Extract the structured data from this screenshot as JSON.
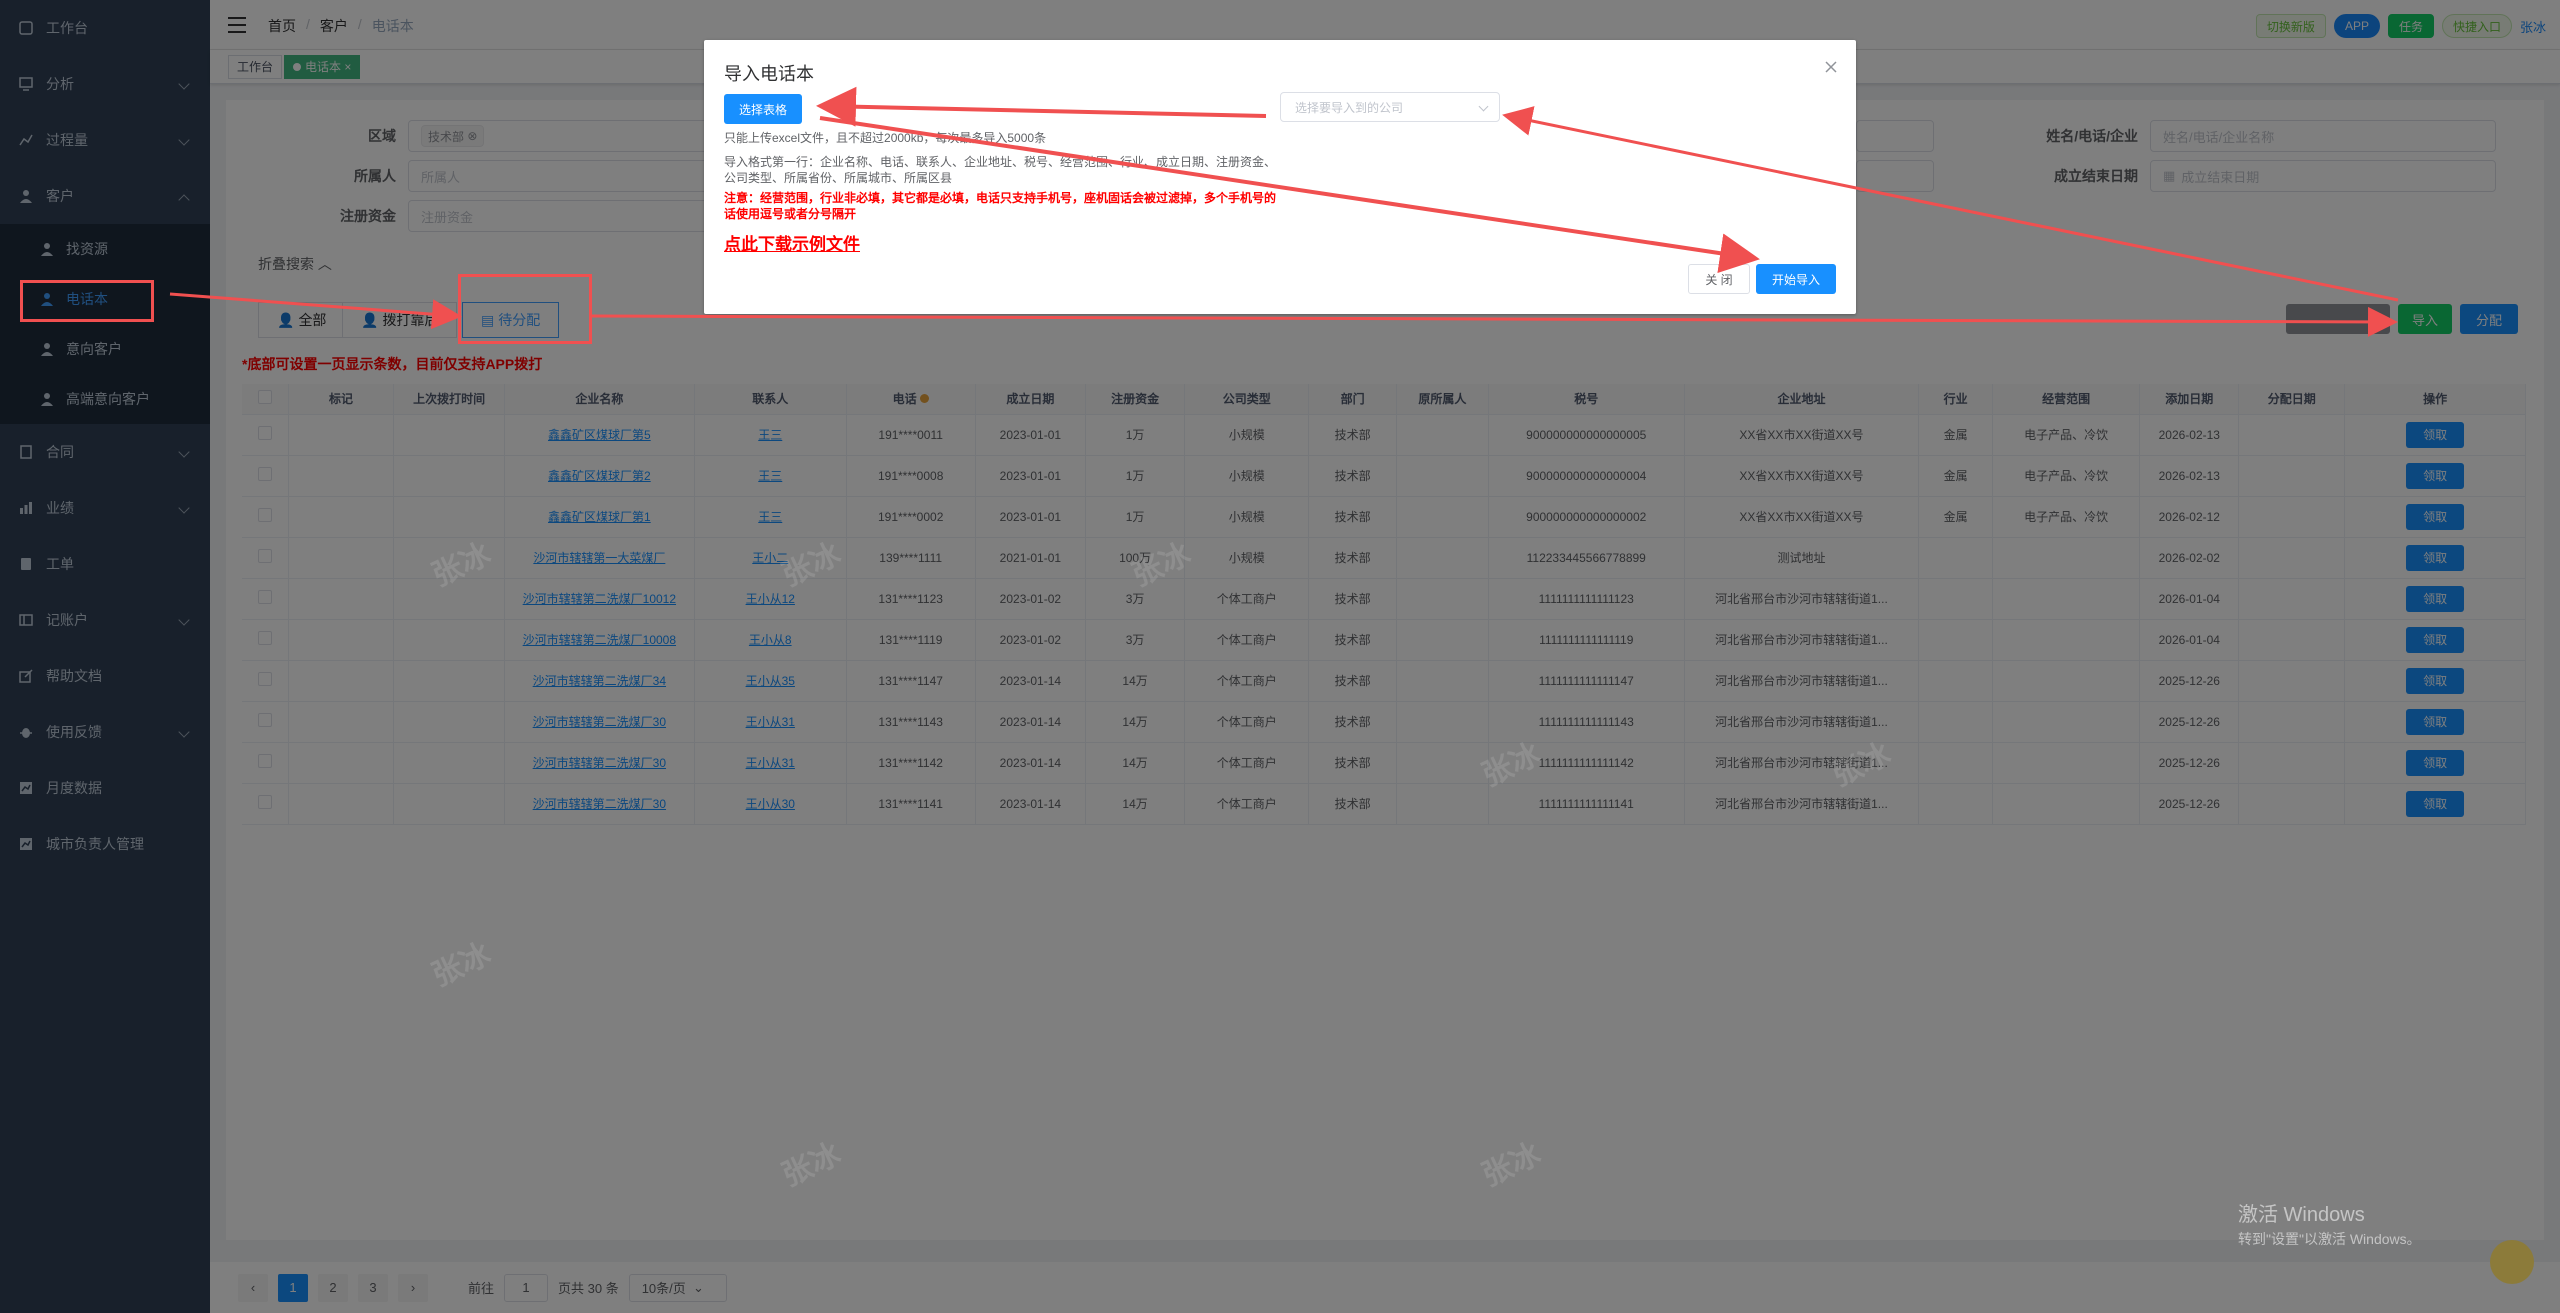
{
  "sidebar": {
    "items": [
      {
        "label": "工作台",
        "icon": "dashboard-icon"
      },
      {
        "label": "分析",
        "icon": "chart-icon"
      },
      {
        "label": "过程量",
        "icon": "process-icon"
      },
      {
        "label": "客户",
        "icon": "user-icon"
      },
      {
        "label": "合同",
        "icon": "contract-icon"
      },
      {
        "label": "业绩",
        "icon": "performance-icon"
      },
      {
        "label": "工单",
        "icon": "ticket-icon"
      },
      {
        "label": "记账户",
        "icon": "account-icon"
      },
      {
        "label": "帮助文档",
        "icon": "link-icon"
      },
      {
        "label": "使用反馈",
        "icon": "bug-icon"
      },
      {
        "label": "月度数据",
        "icon": "monthly-icon"
      },
      {
        "label": "城市负责人管理",
        "icon": "city-icon"
      }
    ],
    "customer_sub": [
      "找资源",
      "电话本",
      "意向客户",
      "高端意向客户"
    ]
  },
  "navbar": {
    "breadcrumb": [
      "首页",
      "客户",
      "电话本"
    ],
    "buttons": [
      "切换新版",
      "APP",
      "任务",
      "快捷入口"
    ],
    "user": "张冰"
  },
  "tags": [
    "工作台",
    "电话本"
  ],
  "filters": {
    "region_label": "区域",
    "region_chip": "技术部",
    "owner_label": "所属人",
    "owner_placeholder": "所属人",
    "capital_label": "注册资金",
    "capital_placeholder": "注册资金",
    "name_label": "姓名/电话/企业",
    "name_placeholder": "姓名/电话/企业名称",
    "end_date_label": "成立结束日期",
    "end_date_placeholder": "成立结束日期",
    "collapse": "折叠搜索"
  },
  "tabs": [
    "全部",
    "拨打靠后",
    "待分配"
  ],
  "tip": "*底部可设置一页显示条数，目前仅支持APP拨打",
  "actions": {
    "import": "导入",
    "assign": "分配"
  },
  "table": {
    "headers": [
      "标记",
      "上次拨打时间",
      "企业名称",
      "联系人",
      "电话",
      "成立日期",
      "注册资金",
      "公司类型",
      "部门",
      "原所属人",
      "税号",
      "企业地址",
      "行业",
      "经营范围",
      "添加日期",
      "分配日期",
      "操作"
    ],
    "action_label": "领取",
    "rows": [
      [
        "",
        "",
        "鑫鑫矿区煤球厂第5",
        "王三",
        "191****0011",
        "2023-01-01",
        "1万",
        "小规模",
        "技术部",
        "",
        "900000000000000005",
        "XX省XX市XX街道XX号",
        "金属",
        "电子产品、冷饮",
        "2026-02-13",
        ""
      ],
      [
        "",
        "",
        "鑫鑫矿区煤球厂第2",
        "王三",
        "191****0008",
        "2023-01-01",
        "1万",
        "小规模",
        "技术部",
        "",
        "900000000000000004",
        "XX省XX市XX街道XX号",
        "金属",
        "电子产品、冷饮",
        "2026-02-13",
        ""
      ],
      [
        "",
        "",
        "鑫鑫矿区煤球厂第1",
        "王三",
        "191****0002",
        "2023-01-01",
        "1万",
        "小规模",
        "技术部",
        "",
        "900000000000000002",
        "XX省XX市XX街道XX号",
        "金属",
        "电子产品、冷饮",
        "2026-02-12",
        ""
      ],
      [
        "",
        "",
        "沙河市辖辖第一大菜煤厂",
        "王小二",
        "139****1111",
        "2021-01-01",
        "100万",
        "小规模",
        "技术部",
        "",
        "112233445566778899",
        "测试地址",
        "",
        "",
        "2026-02-02",
        ""
      ],
      [
        "",
        "",
        "沙河市辖辖第二洗煤厂10012",
        "王小从12",
        "131****1123",
        "2023-01-02",
        "3万",
        "个体工商户",
        "技术部",
        "",
        "1111111111111123",
        "河北省邢台市沙河市辖辖街道1...",
        "",
        "",
        "2026-01-04",
        ""
      ],
      [
        "",
        "",
        "沙河市辖辖第二洗煤厂10008",
        "王小从8",
        "131****1119",
        "2023-01-02",
        "3万",
        "个体工商户",
        "技术部",
        "",
        "1111111111111119",
        "河北省邢台市沙河市辖辖街道1...",
        "",
        "",
        "2026-01-04",
        ""
      ],
      [
        "",
        "",
        "沙河市辖辖第二洗煤厂34",
        "王小从35",
        "131****1147",
        "2023-01-14",
        "14万",
        "个体工商户",
        "技术部",
        "",
        "1111111111111147",
        "河北省邢台市沙河市辖辖街道1...",
        "",
        "",
        "2025-12-26",
        ""
      ],
      [
        "",
        "",
        "沙河市辖辖第二洗煤厂30",
        "王小从31",
        "131****1143",
        "2023-01-14",
        "14万",
        "个体工商户",
        "技术部",
        "",
        "1111111111111143",
        "河北省邢台市沙河市辖辖街道1...",
        "",
        "",
        "2025-12-26",
        ""
      ],
      [
        "",
        "",
        "沙河市辖辖第二洗煤厂30",
        "王小从31",
        "131****1142",
        "2023-01-14",
        "14万",
        "个体工商户",
        "技术部",
        "",
        "1111111111111142",
        "河北省邢台市沙河市辖辖街道1...",
        "",
        "",
        "2025-12-26",
        ""
      ],
      [
        "",
        "",
        "沙河市辖辖第二洗煤厂30",
        "王小从30",
        "131****1141",
        "2023-01-14",
        "14万",
        "个体工商户",
        "技术部",
        "",
        "1111111111111141",
        "河北省邢台市沙河市辖辖街道1...",
        "",
        "",
        "2025-12-26",
        ""
      ]
    ]
  },
  "pagination": {
    "pages": [
      "1",
      "2",
      "3"
    ],
    "goto_label": "前往",
    "goto_value": "1",
    "total": "页共 30 条",
    "page_size": "10条/页"
  },
  "dialog": {
    "title": "导入电话本",
    "select_button": "选择表格",
    "company_placeholder": "选择要导入到的公司",
    "limit_text": "只能上传excel文件，且不超过2000kb，每次最多导入5000条",
    "format_text_1": "导入格式第一行：企业名称、电话、联系人、企业地址、税号、经营范围、行业、成立日期、注册资金、",
    "format_text_2": "公司类型、所属省份、所属城市、所属区县",
    "note_1": "注意：经营范围，行业非必填，其它都是必填，电话只支持手机号，座机固话会被过滤掉，多个手机号的",
    "note_2": "话使用逗号或者分号隔开",
    "download_link": "点此下载示例文件",
    "close_button": "关 闭",
    "start_button": "开始导入"
  },
  "watermark": "张冰",
  "windows_activation": {
    "line1": "激活 Windows",
    "line2": "转到\"设置\"以激活 Windows。"
  },
  "colors": {
    "primary": "#1890ff",
    "annotation": "#f05050",
    "sidebar": "#304156",
    "success": "#13ce66"
  }
}
